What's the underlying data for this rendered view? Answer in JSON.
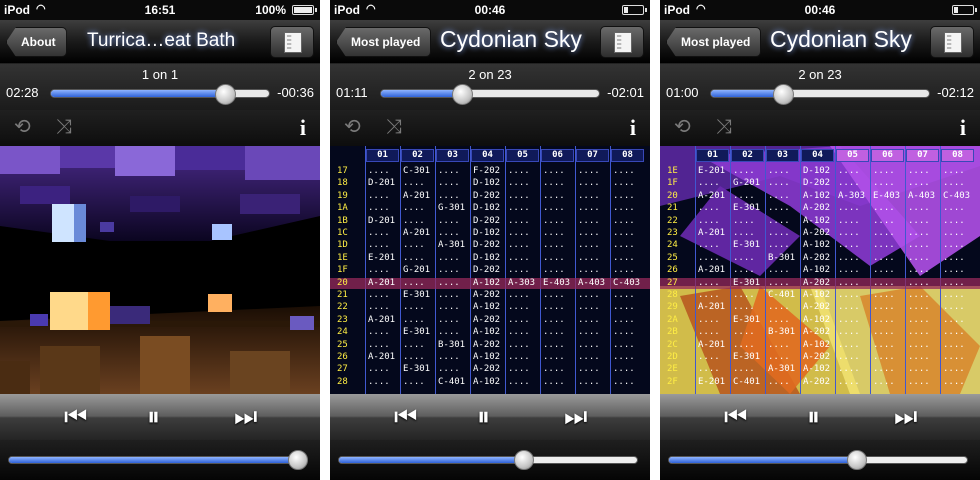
{
  "common": {
    "carrier": "iPod",
    "repeat_icon": "repeat-icon",
    "shuffle_icon": "shuffle-icon",
    "info_label": "i",
    "prev_icon": "⏮",
    "pause_icon": "⏸",
    "next_icon": "⏭",
    "accent_color": "#3f74e6"
  },
  "screens": [
    {
      "clock": "16:51",
      "battery_pct": "100%",
      "battery_fraction": 1.0,
      "back_label": "About",
      "title": "Turrica…eat Bath",
      "track_count": "1 on 1",
      "elapsed": "02:28",
      "remaining": "-00:36",
      "progress": 0.8,
      "volume": 0.97,
      "view": "visualizer"
    },
    {
      "clock": "00:46",
      "battery_pct": "",
      "battery_fraction": 0.2,
      "back_label": "Most played",
      "title": "Cydonian Sky",
      "track_count": "2 on 23",
      "elapsed": "01:11",
      "remaining": "-02:01",
      "progress": 0.37,
      "volume": 0.62,
      "view": "tracker"
    },
    {
      "clock": "00:46",
      "battery_pct": "",
      "battery_fraction": 0.2,
      "back_label": "Most played",
      "title": "Cydonian Sky",
      "track_count": "2 on 23",
      "elapsed": "01:00",
      "remaining": "-02:12",
      "progress": 0.33,
      "volume": 0.63,
      "view": "tracker-overlay"
    }
  ],
  "tracker_a": {
    "channels": [
      "01",
      "02",
      "03",
      "04",
      "05",
      "06",
      "07",
      "08"
    ],
    "highlight_index": 9,
    "rows": [
      {
        "n": "17",
        "c": [
          "....",
          "C-301",
          "....",
          "F-202",
          "....",
          "....",
          "....",
          "...."
        ]
      },
      {
        "n": "18",
        "c": [
          "D-201",
          "....",
          "....",
          "D-102",
          "....",
          "....",
          "....",
          "...."
        ]
      },
      {
        "n": "19",
        "c": [
          "....",
          "A-201",
          "....",
          "D-202",
          "....",
          "....",
          "....",
          "...."
        ]
      },
      {
        "n": "1A",
        "c": [
          "....",
          "....",
          "G-301",
          "D-102",
          "....",
          "....",
          "....",
          "...."
        ]
      },
      {
        "n": "1B",
        "c": [
          "D-201",
          "....",
          "....",
          "D-202",
          "....",
          "....",
          "....",
          "...."
        ]
      },
      {
        "n": "1C",
        "c": [
          "....",
          "A-201",
          "....",
          "D-102",
          "....",
          "....",
          "....",
          "...."
        ]
      },
      {
        "n": "1D",
        "c": [
          "....",
          "....",
          "A-301",
          "D-202",
          "....",
          "....",
          "....",
          "...."
        ]
      },
      {
        "n": "1E",
        "c": [
          "E-201",
          "....",
          "....",
          "D-102",
          "....",
          "....",
          "....",
          "...."
        ]
      },
      {
        "n": "1F",
        "c": [
          "....",
          "G-201",
          "....",
          "D-202",
          "....",
          "....",
          "....",
          "...."
        ]
      },
      {
        "n": "20",
        "c": [
          "A-201",
          "....",
          "....",
          "A-102",
          "A-303",
          "E-403",
          "A-403",
          "C-403"
        ]
      },
      {
        "n": "21",
        "c": [
          "....",
          "E-301",
          "....",
          "A-202",
          "....",
          "....",
          "....",
          "...."
        ]
      },
      {
        "n": "22",
        "c": [
          "....",
          "....",
          "....",
          "A-102",
          "....",
          "....",
          "....",
          "...."
        ]
      },
      {
        "n": "23",
        "c": [
          "A-201",
          "....",
          "....",
          "A-202",
          "....",
          "....",
          "....",
          "...."
        ]
      },
      {
        "n": "24",
        "c": [
          "....",
          "E-301",
          "....",
          "A-102",
          "....",
          "....",
          "....",
          "...."
        ]
      },
      {
        "n": "25",
        "c": [
          "....",
          "....",
          "B-301",
          "A-202",
          "....",
          "....",
          "....",
          "...."
        ]
      },
      {
        "n": "26",
        "c": [
          "A-201",
          "....",
          "....",
          "A-102",
          "....",
          "....",
          "....",
          "...."
        ]
      },
      {
        "n": "27",
        "c": [
          "....",
          "E-301",
          "....",
          "A-202",
          "....",
          "....",
          "....",
          "...."
        ]
      },
      {
        "n": "28",
        "c": [
          "....",
          "....",
          "C-401",
          "A-102",
          "....",
          "....",
          "....",
          "...."
        ]
      }
    ]
  },
  "tracker_b": {
    "channels": [
      "01",
      "02",
      "03",
      "04",
      "05",
      "06",
      "07",
      "08"
    ],
    "highlight_index": 9,
    "rows": [
      {
        "n": "1E",
        "c": [
          "E-201",
          "....",
          "....",
          "D-102",
          "....",
          "....",
          "....",
          "...."
        ]
      },
      {
        "n": "1F",
        "c": [
          "....",
          "G-201",
          "....",
          "D-202",
          "....",
          "....",
          "....",
          "...."
        ]
      },
      {
        "n": "20",
        "c": [
          "A-201",
          "....",
          "....",
          "A-102",
          "A-303",
          "E-403",
          "A-403",
          "C-403"
        ]
      },
      {
        "n": "21",
        "c": [
          "....",
          "E-301",
          "....",
          "A-202",
          "....",
          "....",
          "....",
          "...."
        ]
      },
      {
        "n": "22",
        "c": [
          "....",
          "....",
          "....",
          "A-102",
          "....",
          "....",
          "....",
          "...."
        ]
      },
      {
        "n": "23",
        "c": [
          "A-201",
          "....",
          "....",
          "A-202",
          "....",
          "....",
          "....",
          "...."
        ]
      },
      {
        "n": "24",
        "c": [
          "....",
          "E-301",
          "....",
          "A-102",
          "....",
          "....",
          "....",
          "...."
        ]
      },
      {
        "n": "25",
        "c": [
          "....",
          "....",
          "B-301",
          "A-202",
          "....",
          "....",
          "....",
          "...."
        ]
      },
      {
        "n": "26",
        "c": [
          "A-201",
          "....",
          "....",
          "A-102",
          "....",
          "....",
          "....",
          "...."
        ]
      },
      {
        "n": "27",
        "c": [
          "....",
          "E-301",
          "....",
          "A-202",
          "....",
          "....",
          "....",
          "...."
        ]
      },
      {
        "n": "28",
        "c": [
          "....",
          "....",
          "C-401",
          "A-102",
          "....",
          "....",
          "....",
          "...."
        ]
      },
      {
        "n": "29",
        "c": [
          "A-201",
          "....",
          "....",
          "A-202",
          "....",
          "....",
          "....",
          "...."
        ]
      },
      {
        "n": "2A",
        "c": [
          "....",
          "E-301",
          "....",
          "A-102",
          "....",
          "....",
          "....",
          "...."
        ]
      },
      {
        "n": "2B",
        "c": [
          "....",
          "....",
          "B-301",
          "A-202",
          "....",
          "....",
          "....",
          "...."
        ]
      },
      {
        "n": "2C",
        "c": [
          "A-201",
          "....",
          "....",
          "A-102",
          "....",
          "....",
          "....",
          "...."
        ]
      },
      {
        "n": "2D",
        "c": [
          "....",
          "E-301",
          "....",
          "A-202",
          "....",
          "....",
          "....",
          "...."
        ]
      },
      {
        "n": "2E",
        "c": [
          "....",
          "....",
          "A-301",
          "A-102",
          "....",
          "....",
          "....",
          "...."
        ]
      },
      {
        "n": "2F",
        "c": [
          "E-201",
          "C-401",
          "....",
          "A-202",
          "....",
          "....",
          "....",
          "...."
        ]
      }
    ]
  }
}
